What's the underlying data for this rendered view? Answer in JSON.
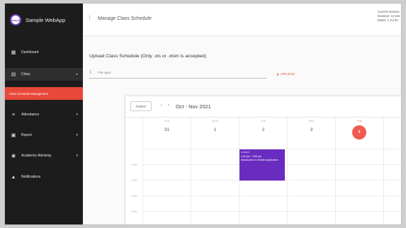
{
  "app": {
    "name": "Sample WebApp",
    "logo_text": "Sample"
  },
  "sidebar": {
    "items": [
      {
        "label": "Dashboard",
        "icon": "dashboard-icon",
        "glyph": "▦",
        "chevron": ""
      },
      {
        "label": "Class",
        "icon": "class-icon",
        "glyph": "▤",
        "chevron": "▸"
      },
      {
        "label": "Class Schedule Management",
        "icon": "",
        "glyph": "",
        "chevron": ""
      },
      {
        "label": "Attendance",
        "icon": "attendance-icon",
        "glyph": "≡",
        "chevron": "▾"
      },
      {
        "label": "Report",
        "icon": "report-icon",
        "glyph": "▣",
        "chevron": "▾"
      },
      {
        "label": "Academic Advising",
        "icon": "advising-icon",
        "glyph": "◉",
        "chevron": "▾"
      },
      {
        "label": "Notifications",
        "icon": "bell-icon",
        "glyph": "▲",
        "chevron": ""
      }
    ]
  },
  "header": {
    "back_glyph": "⁝",
    "title": "Manage Class Schedule",
    "session": [
      "Current Session",
      "Duration: 14 wee",
      "Dates: 1 Jul 20"
    ]
  },
  "upload": {
    "title": "Upload Class Schedule (Only .xls or .xlsm is accepted)",
    "placeholder": "File input",
    "button_label": "UPLOAD",
    "clip_glyph": "⌇"
  },
  "calendar": {
    "today_label": "TODAY",
    "prev_glyph": "‹",
    "next_glyph": "›",
    "range": "Oct - Nov 2021",
    "days": [
      {
        "dow": "SUN",
        "num": "31"
      },
      {
        "dow": "MON",
        "num": "1"
      },
      {
        "dow": "TUE",
        "num": "2"
      },
      {
        "dow": "WED",
        "num": "3"
      },
      {
        "dow": "THU",
        "num": "4"
      }
    ],
    "times": [
      "2 PM",
      "3 PM",
      "4 PM",
      "5 PM"
    ],
    "event": {
      "header": "Lecture",
      "time": "1:00 pm - 3:00 pm",
      "title": "Introduction to Mobile Application"
    }
  },
  "colors": {
    "accent": "#e8483a",
    "event": "#6a2cbf",
    "sidebar": "#1c1c1c"
  }
}
